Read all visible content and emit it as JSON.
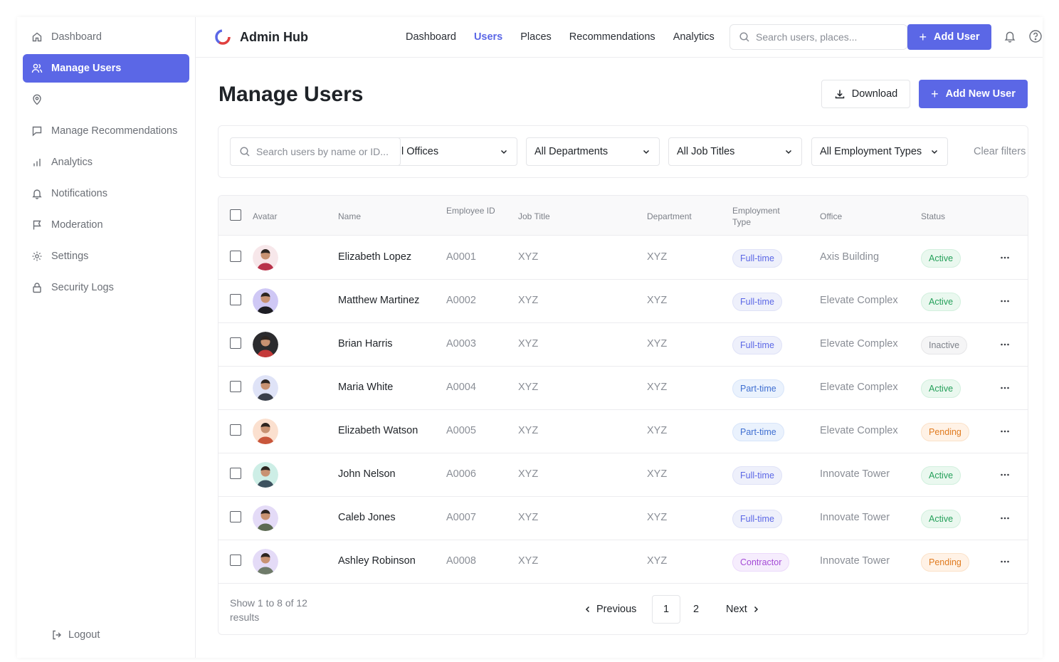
{
  "app": {
    "name": "Admin Hub"
  },
  "sidebar": {
    "items": [
      {
        "label": "Dashboard",
        "icon": "home-icon"
      },
      {
        "label": "Manage Users",
        "icon": "users-icon",
        "active": true
      },
      {
        "label": "",
        "icon": "map-pin-icon"
      },
      {
        "label": "Manage Recommendations",
        "icon": "message-square-icon"
      },
      {
        "label": "Analytics",
        "icon": "bar-chart-icon"
      },
      {
        "label": "Notifications",
        "icon": "bell-icon"
      },
      {
        "label": "Moderation",
        "icon": "flag-icon"
      },
      {
        "label": "Settings",
        "icon": "gear-icon"
      },
      {
        "label": "Security Logs",
        "icon": "lock-icon"
      }
    ],
    "logout_label": "Logout"
  },
  "topnav": {
    "links": [
      "Dashboard",
      "Users",
      "Places",
      "Recommendations",
      "Analytics"
    ],
    "active": "Users",
    "search_placeholder": "Search users, places...",
    "add_user_label": "Add User"
  },
  "page": {
    "title": "Manage Users",
    "download_label": "Download",
    "add_new_label": "Add New User"
  },
  "filters": {
    "search_placeholder": "Search users by name or ID...",
    "offices": "All Offices",
    "offices_visible": "l Offices",
    "departments": "All Departments",
    "job_titles": "All Job Titles",
    "employment_types": "All Employment Types",
    "clear_label": "Clear filters"
  },
  "table": {
    "headers": {
      "avatar": "Avatar",
      "name": "Name",
      "employee_id": "Employee ID",
      "job_title": "Job Title",
      "department": "Department",
      "employment_type": "Employment Type",
      "office": "Office",
      "status": "Status"
    },
    "rows": [
      {
        "name": "Elizabeth Lopez",
        "id": "A0001",
        "job": "XYZ",
        "dept": "XYZ",
        "emp": "Full-time",
        "office": "Axis Building",
        "status": "Active"
      },
      {
        "name": "Matthew Martinez",
        "id": "A0002",
        "job": "XYZ",
        "dept": "XYZ",
        "emp": "Full-time",
        "office": "Elevate Complex",
        "status": "Active"
      },
      {
        "name": "Brian Harris",
        "id": "A0003",
        "job": "XYZ",
        "dept": "XYZ",
        "emp": "Full-time",
        "office": "Elevate Complex",
        "status": "Inactive"
      },
      {
        "name": "Maria White",
        "id": "A0004",
        "job": "XYZ",
        "dept": "XYZ",
        "emp": "Part-time",
        "office": "Elevate Complex",
        "status": "Active"
      },
      {
        "name": "Elizabeth Watson",
        "id": "A0005",
        "job": "XYZ",
        "dept": "XYZ",
        "emp": "Part-time",
        "office": "Elevate Complex",
        "status": "Pending"
      },
      {
        "name": "John Nelson",
        "id": "A0006",
        "job": "XYZ",
        "dept": "XYZ",
        "emp": "Full-time",
        "office": "Innovate Tower",
        "status": "Active"
      },
      {
        "name": "Caleb Jones",
        "id": "A0007",
        "job": "XYZ",
        "dept": "XYZ",
        "emp": "Full-time",
        "office": "Innovate Tower",
        "status": "Active"
      },
      {
        "name": "Ashley Robinson",
        "id": "A0008",
        "job": "XYZ",
        "dept": "XYZ",
        "emp": "Contractor",
        "office": "Innovate Tower",
        "status": "Pending"
      }
    ]
  },
  "pagination": {
    "summary": "Show 1 to 8 of 12 results",
    "previous": "Previous",
    "pages": [
      "1",
      "2"
    ],
    "current": "1",
    "next": "Next"
  },
  "colors": {
    "accent": "#5b67e6",
    "active": "#25a05a",
    "pending": "#e07b20",
    "inactive": "#7d8189"
  }
}
